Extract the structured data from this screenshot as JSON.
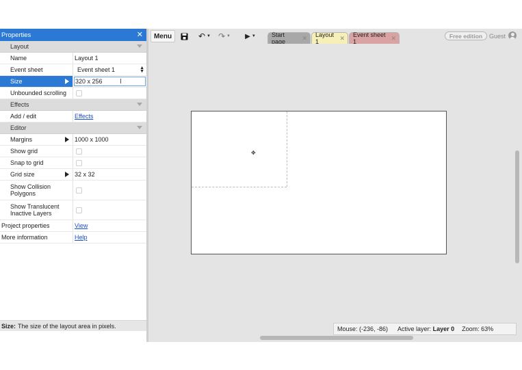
{
  "panel": {
    "title": "Properties",
    "sections": {
      "layout": "Layout",
      "effects": "Effects",
      "editor": "Editor"
    },
    "props": {
      "name": {
        "label": "Name",
        "value": "Layout 1"
      },
      "event_sheet": {
        "label": "Event sheet",
        "value": "Event sheet 1"
      },
      "size": {
        "label": "Size",
        "value": "320 x 256"
      },
      "unbounded_scrolling": {
        "label": "Unbounded scrolling",
        "checked": false
      },
      "add_edit": {
        "label": "Add / edit",
        "value": "Effects"
      },
      "margins": {
        "label": "Margins",
        "value": "1000 x 1000"
      },
      "show_grid": {
        "label": "Show grid",
        "checked": false
      },
      "snap_to_grid": {
        "label": "Snap to grid",
        "checked": false
      },
      "grid_size": {
        "label": "Grid size",
        "value": "32 x 32"
      },
      "show_collision": {
        "label": "Show Collision Polygons",
        "checked": false
      },
      "show_translucent": {
        "label": "Show Translucent Inactive Layers",
        "checked": false
      },
      "project_properties": {
        "label": "Project properties",
        "value": "View"
      },
      "more_information": {
        "label": "More information",
        "value": "Help"
      }
    },
    "status": {
      "bold": "Size:",
      "text": "The size of the layout area in pixels."
    }
  },
  "toolbar": {
    "menu_label": "Menu",
    "tabs": [
      "Start page",
      "Layout 1",
      "Event sheet 1"
    ],
    "free_edition": "Free edition",
    "guest": "Guest"
  },
  "status_bar": {
    "mouse": "Mouse: (-236, -86)",
    "active_layer_label": "Active layer:",
    "active_layer_value": "Layer 0",
    "zoom": "Zoom: 63%"
  },
  "colors": {
    "accent": "#2b79d4",
    "tab_start": "#a8a8a8",
    "tab_layout": "#f7efb8",
    "tab_event": "#d9a3a3"
  }
}
